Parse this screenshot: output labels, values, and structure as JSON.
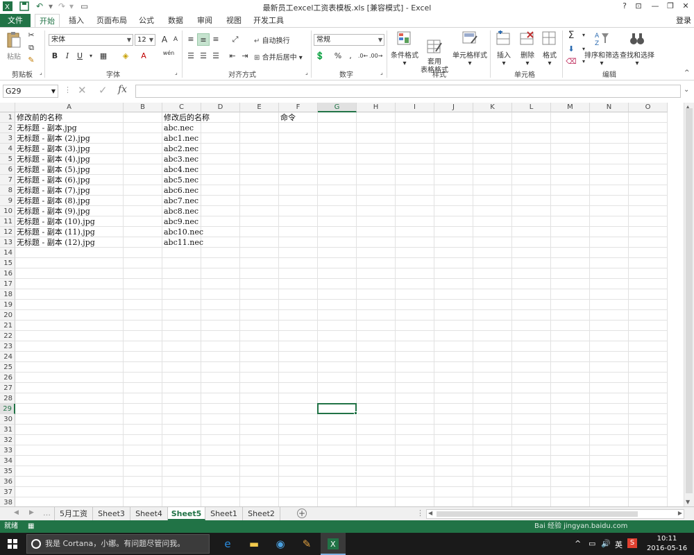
{
  "window": {
    "title": "最新员工excel工资表模板.xls  [兼容模式] - Excel",
    "help": "?",
    "controls": {
      "restore_ribbon": "⊡",
      "minimize": "—",
      "maximize": "❐",
      "close": "✕"
    }
  },
  "tabs": {
    "file": "文件",
    "items": [
      "开始",
      "插入",
      "页面布局",
      "公式",
      "数据",
      "审阅",
      "视图",
      "开发工具"
    ],
    "active": "开始",
    "login": "登录"
  },
  "ribbon": {
    "clipboard": {
      "label": "剪贴板",
      "paste": "粘贴"
    },
    "font": {
      "label": "字体",
      "name": "宋体",
      "size": "12",
      "bold": "B",
      "italic": "I",
      "underline": "U",
      "grow": "A",
      "shrink": "A",
      "color": "A",
      "phonetic": "wén"
    },
    "alignment": {
      "label": "对齐方式",
      "wrap": "自动换行",
      "merge": "合并后居中"
    },
    "number": {
      "label": "数字",
      "format": "常规",
      "percent": "%",
      "comma": ","
    },
    "styles": {
      "label": "样式",
      "conditional": "条件格式",
      "table": "套用\n表格格式",
      "cell_styles": "单元格样式"
    },
    "cells": {
      "label": "单元格",
      "insert": "插入",
      "delete": "删除",
      "format": "格式"
    },
    "editing": {
      "label": "编辑",
      "sort": "排序和筛选",
      "find": "查找和选择",
      "sigma": "Σ"
    }
  },
  "formula_bar": {
    "name_box": "G29",
    "fx": "fx",
    "cancel": "✕",
    "enter": "✓",
    "value": ""
  },
  "grid": {
    "columns": [
      "A",
      "B",
      "C",
      "D",
      "E",
      "F",
      "G",
      "H",
      "I",
      "J",
      "K",
      "L",
      "M",
      "N",
      "O"
    ],
    "selected_column": "G",
    "selected_row": 29,
    "row_count": 38,
    "cells": {
      "A1": "修改前的名称",
      "C1": "修改后的名称",
      "F1": "命令",
      "A2": "无标题 - 副本.jpg",
      "C2": "abc.nec",
      "A3": "无标题 - 副本 (2).jpg",
      "C3": "abc1.nec",
      "A4": "无标题 - 副本 (3).jpg",
      "C4": "abc2.nec",
      "A5": "无标题 - 副本 (4).jpg",
      "C5": "abc3.nec",
      "A6": "无标题 - 副本 (5).jpg",
      "C6": "abc4.nec",
      "A7": "无标题 - 副本 (6).jpg",
      "C7": "abc5.nec",
      "A8": "无标题 - 副本 (7).jpg",
      "C8": "abc6.nec",
      "A9": "无标题 - 副本 (8).jpg",
      "C9": "abc7.nec",
      "A10": "无标题 - 副本 (9).jpg",
      "C10": "abc8.nec",
      "A11": "无标题 - 副本 (10).jpg",
      "C11": "abc9.nec",
      "A12": "无标题 - 副本 (11).jpg",
      "C12": "abc10.nec",
      "A13": "无标题 - 副本 (12).jpg",
      "C13": "abc11.nec"
    }
  },
  "sheets": {
    "items": [
      "5月工资",
      "Sheet3",
      "Sheet4",
      "Sheet5",
      "Sheet1",
      "Sheet2"
    ],
    "active": "Sheet5",
    "add": "+"
  },
  "status": {
    "ready": "就绪"
  },
  "taskbar": {
    "cortana": "我是 Cortana，小娜。有问题尽管问我。",
    "ime": "英",
    "time": "10:11",
    "date": "2016-05-16"
  },
  "watermark": "Bai 经验 jingyan.baidu.com"
}
